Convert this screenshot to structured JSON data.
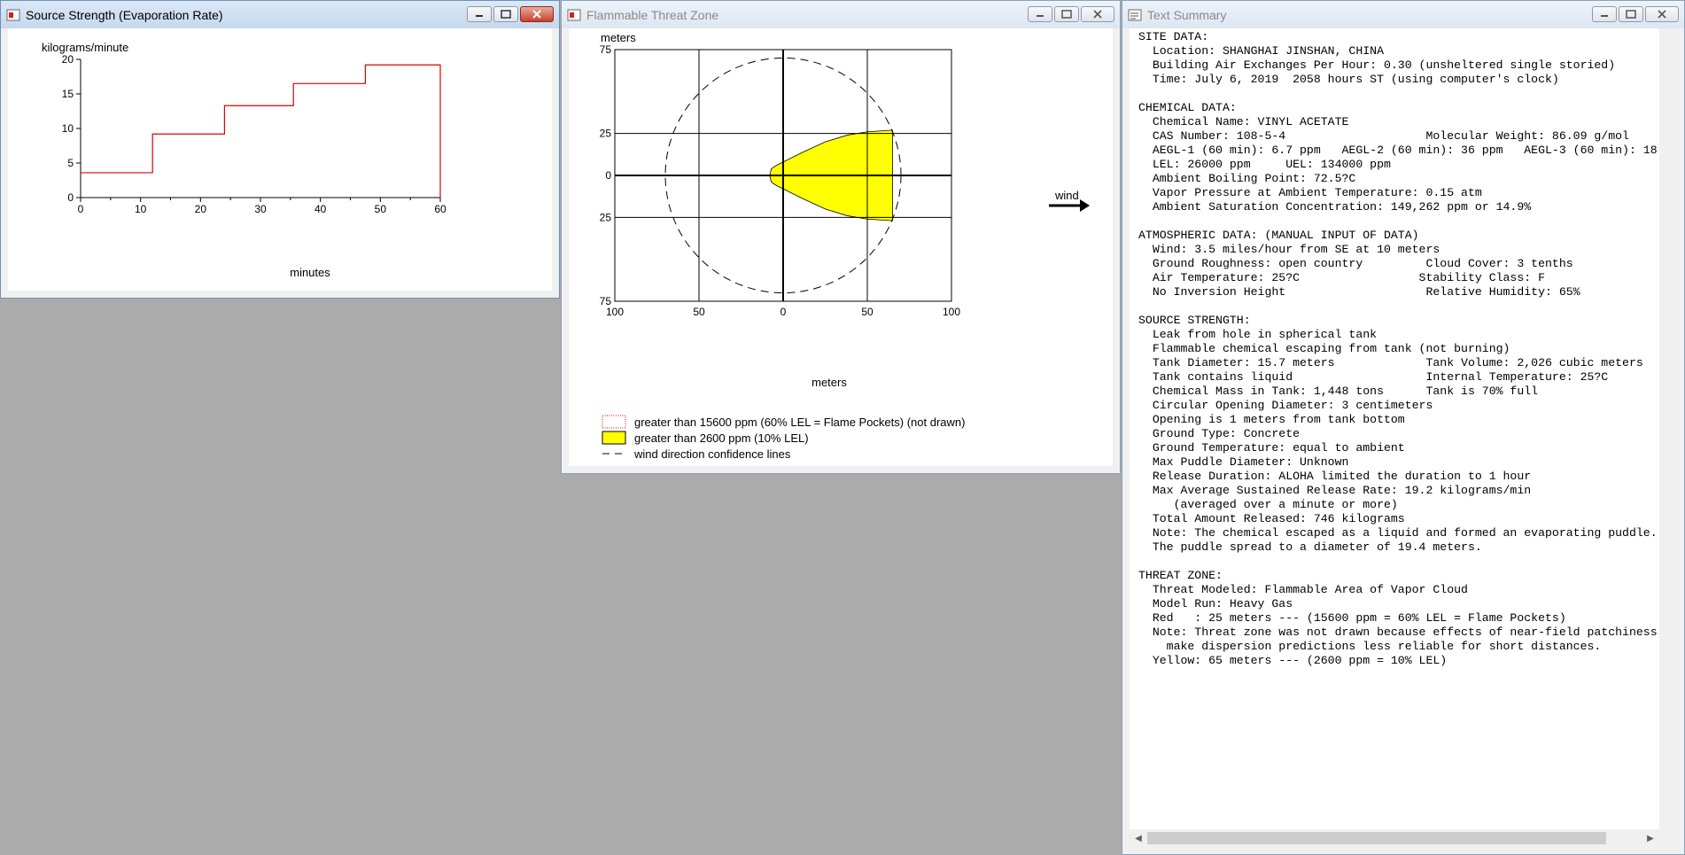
{
  "windows": {
    "source": {
      "title": "Source Strength (Evaporation Rate)"
    },
    "threat": {
      "title": "Flammable Threat Zone"
    },
    "summary": {
      "title": "Text Summary"
    }
  },
  "source_chart": {
    "chart_data": {
      "type": "line",
      "ylabel": "kilograms/minute",
      "xlabel": "minutes",
      "xlim": [
        0,
        60
      ],
      "ylim": [
        0,
        20
      ],
      "x_ticks": [
        "0",
        "10",
        "20",
        "30",
        "40",
        "50",
        "60"
      ],
      "y_ticks": [
        "0",
        "5",
        "10",
        "15",
        "20"
      ],
      "series": [
        {
          "color": "#e00000",
          "points": [
            [
              0,
              3.6
            ],
            [
              12,
              3.6
            ],
            [
              12,
              9.2
            ],
            [
              24,
              9.2
            ],
            [
              24,
              13.3
            ],
            [
              35.5,
              13.3
            ],
            [
              35.5,
              16.5
            ],
            [
              47.5,
              16.5
            ],
            [
              47.5,
              19.2
            ],
            [
              60,
              19.2
            ],
            [
              60,
              0
            ]
          ]
        }
      ]
    }
  },
  "threat_chart": {
    "chart_data": {
      "type": "area",
      "ylabel": "meters",
      "xlabel": "meters",
      "xlim": [
        -100,
        100
      ],
      "ylim": [
        -75,
        75
      ],
      "x_ticks": [
        "100",
        "50",
        "0",
        "50",
        "100"
      ],
      "y_ticks": [
        "75",
        "25",
        "0",
        "25",
        "75"
      ],
      "confidence_circle_radius": 70,
      "threat_zone": {
        "color": "#ffff00",
        "points": [
          [
            -7,
            4
          ],
          [
            -4,
            6
          ],
          [
            2,
            9
          ],
          [
            12,
            14
          ],
          [
            25,
            20
          ],
          [
            38,
            24
          ],
          [
            50,
            26
          ],
          [
            65,
            27
          ],
          [
            65,
            -27
          ],
          [
            50,
            -26
          ],
          [
            38,
            -24
          ],
          [
            25,
            -20
          ],
          [
            12,
            -14
          ],
          [
            2,
            -9
          ],
          [
            -4,
            -6
          ],
          [
            -7,
            -4
          ],
          [
            -8,
            0
          ]
        ]
      },
      "wind_label": "wind",
      "legend": [
        {
          "label": "greater than 15600 ppm (60% LEL = Flame Pockets) (not drawn)",
          "style": "dotted-red"
        },
        {
          "label": "greater than 2600 ppm (10% LEL)",
          "style": "yellow"
        },
        {
          "label": "wind direction confidence lines",
          "style": "dashed"
        }
      ]
    }
  },
  "summary_lines": [
    "SITE DATA:",
    "  Location: SHANGHAI JINSHAN, CHINA",
    "  Building Air Exchanges Per Hour: 0.30 (unsheltered single storied)",
    "  Time: July 6, 2019  2058 hours ST (using computer's clock)",
    "",
    "CHEMICAL DATA:",
    "  Chemical Name: VINYL ACETATE",
    "  CAS Number: 108-5-4                    Molecular Weight: 86.09 g/mol",
    "  AEGL-1 (60 min): 6.7 ppm   AEGL-2 (60 min): 36 ppm   AEGL-3 (60 min): 18",
    "  LEL: 26000 ppm     UEL: 134000 ppm",
    "  Ambient Boiling Point: 72.5?C",
    "  Vapor Pressure at Ambient Temperature: 0.15 atm",
    "  Ambient Saturation Concentration: 149,262 ppm or 14.9%",
    "",
    "ATMOSPHERIC DATA: (MANUAL INPUT OF DATA)",
    "  Wind: 3.5 miles/hour from SE at 10 meters",
    "  Ground Roughness: open country         Cloud Cover: 3 tenths",
    "  Air Temperature: 25?C                 Stability Class: F",
    "  No Inversion Height                    Relative Humidity: 65%",
    "",
    "SOURCE STRENGTH:",
    "  Leak from hole in spherical tank",
    "  Flammable chemical escaping from tank (not burning)",
    "  Tank Diameter: 15.7 meters             Tank Volume: 2,026 cubic meters",
    "  Tank contains liquid                   Internal Temperature: 25?C",
    "  Chemical Mass in Tank: 1,448 tons      Tank is 70% full",
    "  Circular Opening Diameter: 3 centimeters",
    "  Opening is 1 meters from tank bottom",
    "  Ground Type: Concrete",
    "  Ground Temperature: equal to ambient",
    "  Max Puddle Diameter: Unknown",
    "  Release Duration: ALOHA limited the duration to 1 hour",
    "  Max Average Sustained Release Rate: 19.2 kilograms/min",
    "     (averaged over a minute or more)",
    "  Total Amount Released: 746 kilograms",
    "  Note: The chemical escaped as a liquid and formed an evaporating puddle.",
    "  The puddle spread to a diameter of 19.4 meters.",
    "",
    "THREAT ZONE:",
    "  Threat Modeled: Flammable Area of Vapor Cloud",
    "  Model Run: Heavy Gas",
    "  Red   : 25 meters --- (15600 ppm = 60% LEL = Flame Pockets)",
    "  Note: Threat zone was not drawn because effects of near-field patchiness",
    "    make dispersion predictions less reliable for short distances.",
    "  Yellow: 65 meters --- (2600 ppm = 10% LEL)"
  ]
}
